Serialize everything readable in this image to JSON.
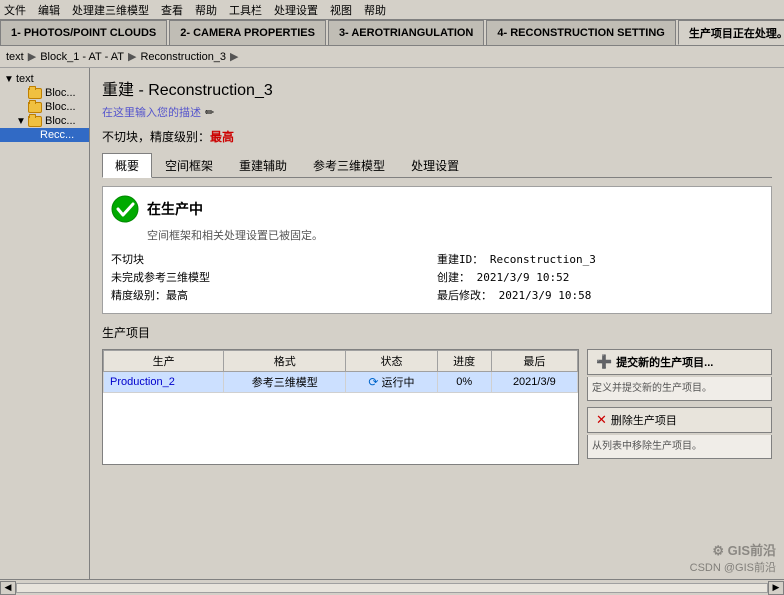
{
  "topMenu": {
    "items": [
      "文件",
      "编辑",
      "处理建三维模型",
      "查看",
      "帮助",
      "工具栏",
      "处理设置",
      "视图",
      "帮助"
    ]
  },
  "tabs": [
    {
      "id": "tab1",
      "label": "1- PHOTOS/POINT CLOUDS",
      "active": false
    },
    {
      "id": "tab2",
      "label": "2- CAMERA PROPERTIES",
      "active": false
    },
    {
      "id": "tab3",
      "label": "3- AEROTRIANGULATION",
      "active": false
    },
    {
      "id": "tab4",
      "label": "4- RECONSTRUCTION SETTING",
      "active": false
    },
    {
      "id": "tab5",
      "label": "生产项目正在处理。",
      "active": true,
      "hasClose": true
    }
  ],
  "breadcrumb": {
    "parts": [
      "text",
      "Block_1 - AT - AT",
      "Reconstruction_3"
    ]
  },
  "sidebar": {
    "treeItems": [
      {
        "label": "text",
        "level": 0,
        "type": "root",
        "expanded": true
      },
      {
        "label": "Bloc...",
        "level": 1,
        "type": "folder"
      },
      {
        "label": "Bloc...",
        "level": 1,
        "type": "folder"
      },
      {
        "label": "Bloc...",
        "level": 1,
        "type": "folder",
        "expanded": true
      },
      {
        "label": "Recc...",
        "level": 2,
        "type": "item",
        "selected": true
      }
    ]
  },
  "contentPanel": {
    "title": "重建 - Reconstruction_3",
    "descriptionPlaceholder": "在这里输入您的描述",
    "infoLine": "不切块，精度级别：",
    "infoValue": "最高",
    "tabs": [
      {
        "label": "概要",
        "active": true
      },
      {
        "label": "空间框架"
      },
      {
        "label": "重建辅助"
      },
      {
        "label": "参考三维模型"
      },
      {
        "label": "处理设置"
      }
    ],
    "status": {
      "title": "在生产中",
      "subtitle": "空间框架和相关处理设置已被固定。",
      "iconType": "success"
    },
    "detailsLeft": [
      {
        "label": "不切块"
      },
      {
        "label": "未完成参考三维模型"
      },
      {
        "label": "精度级别：最高"
      }
    ],
    "detailsRight": [
      {
        "label": "重建ID：",
        "value": "Reconstruction_3"
      },
      {
        "label": "创建：",
        "value": "2021/3/9  10:52"
      },
      {
        "label": "最后修改：",
        "value": "2021/3/9  10:58"
      }
    ],
    "productionSection": {
      "label": "生产项目",
      "tableHeaders": [
        "生产",
        "格式",
        "状态",
        "进度",
        "最后"
      ],
      "rows": [
        {
          "production": "Production_2",
          "format": "参考三维模型",
          "status": "运行中",
          "progress": "0%",
          "last": "2021/3/9"
        }
      ]
    },
    "actions": [
      {
        "label": "提交新的生产项目...",
        "desc": "定义并提交新的生产项目。",
        "icon": "➕",
        "type": "primary"
      },
      {
        "label": "删除生产项目",
        "desc": "从列表中移除生产项目。",
        "icon": "✕",
        "type": "normal"
      }
    ]
  },
  "watermark": {
    "logo": "⚙ GIS前沿",
    "sub": "CSDN @GIS前沿"
  },
  "colors": {
    "accent": "#316ac5",
    "success": "#00aa00",
    "danger": "#cc0000",
    "tabActive": "#d4d0c8",
    "tabInactive": "#c0bdb5"
  }
}
